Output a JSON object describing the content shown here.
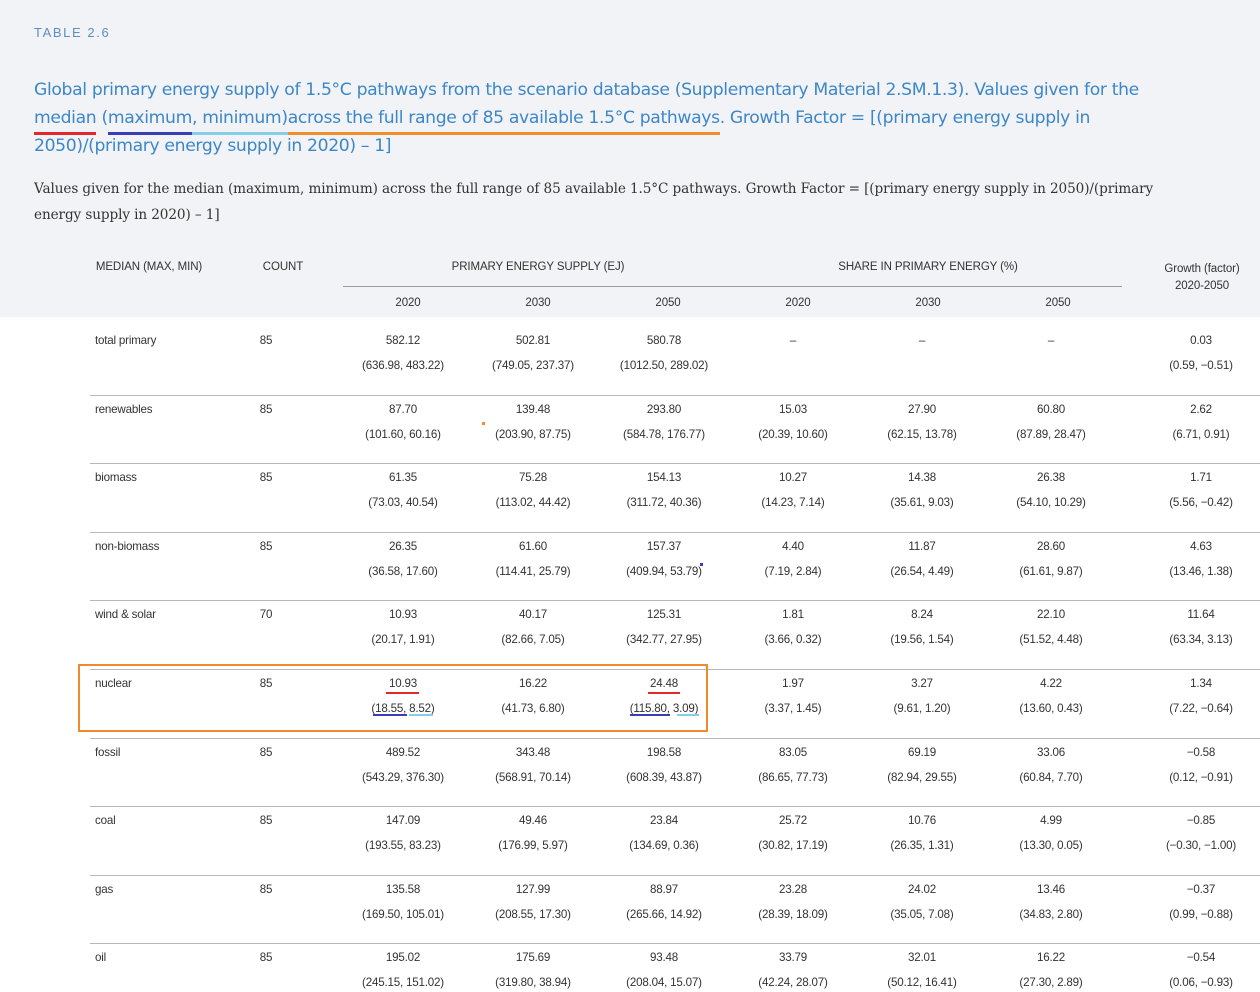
{
  "table_label": "TABLE 2.6",
  "caption": {
    "part1": "Global primary energy supply of 1.5°C pathways from the scenario database (Supplementary Material 2.SM.1.3). Values given for the ",
    "median": "median",
    "paren_open": " (",
    "maximum": "maximum",
    "comma": ", ",
    "minimum": "minimum",
    "paren_close": ") ",
    "range": "across the full range of 85 available 1.5°C pathways",
    "part2": ". Growth Factor = [(primary energy supply in 2050)/(primary energy supply in 2020) – 1]"
  },
  "body_text": "Values given for the median (maximum, minimum) across the full range of 85 available 1.5°C pathways. Growth Factor = [(primary energy supply in 2050)/(primary energy supply in 2020) – 1]",
  "headers": {
    "median": "MEDIAN (MAX, MIN)",
    "count": "COUNT",
    "primary_supply": "PRIMARY ENERGY SUPPLY (EJ)",
    "share": "SHARE IN PRIMARY ENERGY (%)",
    "growth_line1": "Growth (factor)",
    "growth_line2": "2020-2050",
    "years": [
      "2020",
      "2030",
      "2050",
      "2020",
      "2030",
      "2050"
    ]
  },
  "rows": [
    {
      "name": "total primary",
      "count": "85",
      "values": [
        [
          "582.12",
          "(636.98, 483.22)"
        ],
        [
          "502.81",
          "(749.05, 237.37)"
        ],
        [
          "580.78",
          "(1012.50, 289.02)"
        ],
        [
          "–",
          ""
        ],
        [
          "–",
          ""
        ],
        [
          "–",
          ""
        ],
        [
          "0.03",
          "(0.59, −0.51)"
        ]
      ]
    },
    {
      "name": "renewables",
      "count": "85",
      "values": [
        [
          "87.70",
          "(101.60, 60.16)"
        ],
        [
          "139.48",
          "(203.90, 87.75)"
        ],
        [
          "293.80",
          "(584.78, 176.77)"
        ],
        [
          "15.03",
          "(20.39, 10.60)"
        ],
        [
          "27.90",
          "(62.15, 13.78)"
        ],
        [
          "60.80",
          "(87.89, 28.47)"
        ],
        [
          "2.62",
          "(6.71, 0.91)"
        ]
      ]
    },
    {
      "name": "biomass",
      "count": "85",
      "values": [
        [
          "61.35",
          "(73.03, 40.54)"
        ],
        [
          "75.28",
          "(113.02, 44.42)"
        ],
        [
          "154.13",
          "(311.72, 40.36)"
        ],
        [
          "10.27",
          "(14.23, 7.14)"
        ],
        [
          "14.38",
          "(35.61, 9.03)"
        ],
        [
          "26.38",
          "(54.10, 10.29)"
        ],
        [
          "1.71",
          "(5.56, −0.42)"
        ]
      ]
    },
    {
      "name": "non-biomass",
      "count": "85",
      "values": [
        [
          "26.35",
          "(36.58, 17.60)"
        ],
        [
          "61.60",
          "(114.41, 25.79)"
        ],
        [
          "157.37",
          "(409.94, 53.79)"
        ],
        [
          "4.40",
          "(7.19, 2.84)"
        ],
        [
          "11.87",
          "(26.54, 4.49)"
        ],
        [
          "28.60",
          "(61.61, 9.87)"
        ],
        [
          "4.63",
          "(13.46, 1.38)"
        ]
      ]
    },
    {
      "name": "wind & solar",
      "count": "70",
      "values": [
        [
          "10.93",
          "(20.17, 1.91)"
        ],
        [
          "40.17",
          "(82.66, 7.05)"
        ],
        [
          "125.31",
          "(342.77, 27.95)"
        ],
        [
          "1.81",
          "(3.66, 0.32)"
        ],
        [
          "8.24",
          "(19.56, 1.54)"
        ],
        [
          "22.10",
          "(51.52, 4.48)"
        ],
        [
          "11.64",
          "(63.34, 3.13)"
        ]
      ]
    },
    {
      "name": "nuclear",
      "count": "85",
      "values": [
        [
          "10.93",
          "(18.55, 8.52)"
        ],
        [
          "16.22",
          "(41.73, 6.80)"
        ],
        [
          "24.48",
          "(115.80, 3.09)"
        ],
        [
          "1.97",
          "(3.37, 1.45)"
        ],
        [
          "3.27",
          "(9.61, 1.20)"
        ],
        [
          "4.22",
          "(13.60, 0.43)"
        ],
        [
          "1.34",
          "(7.22, −0.64)"
        ]
      ]
    },
    {
      "name": "fossil",
      "count": "85",
      "values": [
        [
          "489.52",
          "(543.29, 376.30)"
        ],
        [
          "343.48",
          "(568.91, 70.14)"
        ],
        [
          "198.58",
          "(608.39, 43.87)"
        ],
        [
          "83.05",
          "(86.65, 77.73)"
        ],
        [
          "69.19",
          "(82.94, 29.55)"
        ],
        [
          "33.06",
          "(60.84, 7.70)"
        ],
        [
          "−0.58",
          "(0.12, −0.91)"
        ]
      ]
    },
    {
      "name": "coal",
      "count": "85",
      "values": [
        [
          "147.09",
          "(193.55, 83.23)"
        ],
        [
          "49.46",
          "(176.99, 5.97)"
        ],
        [
          "23.84",
          "(134.69, 0.36)"
        ],
        [
          "25.72",
          "(30.82, 17.19)"
        ],
        [
          "10.76",
          "(26.35, 1.31)"
        ],
        [
          "4.99",
          "(13.30, 0.05)"
        ],
        [
          "−0.85",
          "(−0.30, −1.00)"
        ]
      ]
    },
    {
      "name": "gas",
      "count": "85",
      "values": [
        [
          "135.58",
          "(169.50, 105.01)"
        ],
        [
          "127.99",
          "(208.55, 17.30)"
        ],
        [
          "88.97",
          "(265.66, 14.92)"
        ],
        [
          "23.28",
          "(28.39, 18.09)"
        ],
        [
          "24.02",
          "(35.05, 7.08)"
        ],
        [
          "13.46",
          "(34.83, 2.80)"
        ],
        [
          "−0.37",
          "(0.99, −0.88)"
        ]
      ]
    },
    {
      "name": "oil",
      "count": "85",
      "values": [
        [
          "195.02",
          "(245.15, 151.02)"
        ],
        [
          "175.69",
          "(319.80, 38.94)"
        ],
        [
          "93.48",
          "(208.04, 15.07)"
        ],
        [
          "33.79",
          "(42.24, 28.07)"
        ],
        [
          "32.01",
          "(50.12, 16.41)"
        ],
        [
          "16.22",
          "(27.30, 2.89)"
        ],
        [
          "−0.54",
          "(0.06, −0.93)"
        ]
      ]
    }
  ],
  "colors": {
    "caption": "#3d87c8",
    "median_mark": "#e3282d",
    "maximum_mark": "#3a3fb7",
    "minimum_mark": "#86cde8",
    "range_mark": "#f28c28",
    "highlight_box": "#f08a2c"
  }
}
